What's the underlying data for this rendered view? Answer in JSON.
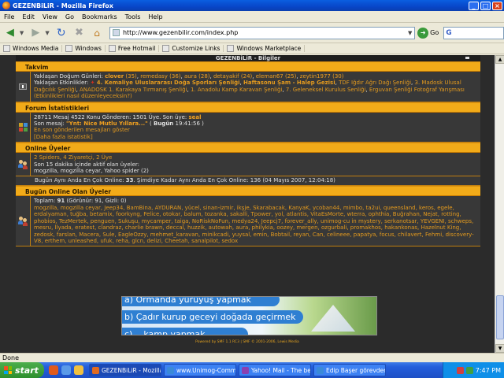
{
  "window": {
    "title": "GEZENBiLiR - Mozilla Firefox",
    "min": "_",
    "max": "□",
    "close": "×"
  },
  "menu": [
    "File",
    "Edit",
    "View",
    "Go",
    "Bookmarks",
    "Tools",
    "Help"
  ],
  "nav": {
    "url": "http://www.gezenbilir.com/index.php",
    "go_label": "Go",
    "search_engine": "G"
  },
  "bookmarks": [
    "Windows Media",
    "Windows",
    "Free Hotmail",
    "Customize Links",
    "Windows Marketplace"
  ],
  "page": {
    "topbar": "GEZENBiLiR - Bilgiler",
    "takvim": {
      "title": "Takvim",
      "birthday_label": "Yaklaşan Doğum Günleri:",
      "birthdays": [
        {
          "name": "clover",
          "age": "(35)"
        },
        {
          "name": "remedasy",
          "age": "(36)"
        },
        {
          "name": "aura",
          "age": "(28)"
        },
        {
          "name": "detayakif",
          "age": "(24)"
        },
        {
          "name": "eleman67",
          "age": "(25)"
        },
        {
          "name": "zeytin1977",
          "age": "(30)"
        }
      ],
      "events_label": "Yaklaşan Etkinlikler:",
      "events": [
        "4. Kemaliye Uluslararası Doğa Sporları Şenliği",
        "Haftasonu Şam - Halep Gezisi",
        "TDF Iğdır Ağrı Dağı Şenliği",
        "3. Madosk Ulusal Dağcılık Şenliği",
        "ANADOSK 1. Karakaya Tırmanış Şenliği",
        "1. Anadolu Kamp Karavan Şenliği",
        "7. Geleneksel Kurulus Senliği",
        "Erguvan Şenliği Fotoğraf Yarışması"
      ],
      "edit_link": "(Etkinlikleri nasıl düzenleyeceksin?)"
    },
    "stats": {
      "title": "Forum İstatistikleri",
      "line1_prefix": "28711 Mesaj 4522 Konu Gönderen: 1501 Üye. Son üye:",
      "last_member": "seal",
      "last_msg_label": "Son mesaj:",
      "last_msg_title": "\"Ynt: Nice Mutlu Yıllara...\"",
      "last_msg_when_prefix": "( ",
      "last_msg_when_day": "Bugün",
      "last_msg_when_time": "19:41:56 )",
      "recent_link": "En son gönderilen mesajları göster",
      "more_link": "[Daha fazla istatistik]"
    },
    "online": {
      "title": "Online Üyeler",
      "summary": "2 Spiders, 4 Ziyaretçi, 2 Üye",
      "last15": "Son 15 dakika içinde aktif olan üyeler:",
      "users": "mogzilla, mogzilla ceyar, Yahoo spider (2)",
      "strip_prefix": "Bugün Aynı Anda En Çok Online:",
      "strip_count": "33",
      "strip_suffix": ". Şimdiye Kadar Aynı Anda En Çok Online: 136 (04 Mayıs 2007, 12:04:18)"
    },
    "today": {
      "title": "Bugün Online Olan Üyeler",
      "total_label": "Toplam:",
      "total_count": "91",
      "total_rest": "(Görünür: 91, Gizli: 0)",
      "users": "mogzilla, mogzilla ceyar, Jeep34, BamBina, AYDURAN, yücel, sinan-izmir, ikşje, Skarabacak, KanyaK, ycoban44, mimbo, ta2ui, queensland, keros, egele, erdalyaman, tuğba, betamix, foorkyng, Felice, otokar, balum, tozanka, sakalli, Tpower, yol, atlantis, VitaEsMorte, wterra, ophthia, Buğrahan, Nejat, rotting, phobios, TezMertek, penguen, Sukuşu, mycamper, taiga, NoRiskNoFun, medya24, Jeepcj7, forever_ally, unimog-cu in mystery, serkanotsar, YEVGENI, schweps, mesru, İlyada, eratest, clandraz, charlie brawn, deccal, huzzik, autowah, aura, philykia, oozey, mergen, ozgurbali, promakhos, hakankonas, Hazelnut King, zedosk, farslan, Macera, Sule, EagleOzzy, mehmet_karavan, minikcadi, yuysal, emin, Bobtail, reyan, Can, celineee, papatya, focus, chilavert, Fehmi, discovery-V8, erthem, unleashed, ufuk, reha, glcn, delizi, Cheetah, sanalpilot, sedox"
    },
    "banner": {
      "line1": "a) Ormanda yürüyüş yapmak",
      "line2": "b) Çadır kurup geceyi doğada geçirmek",
      "line3": "c) ...kamp yapmak"
    },
    "footer": "Powered by SMF 1.1 RC3 | SMF © 2001-2006, Lewis Media"
  },
  "status": "Done",
  "taskbar": {
    "start": "start",
    "tasks": [
      "GEZENBiLiR - Mozilla F...",
      "www.Unimog-Commu...",
      "Yahoo! Mail - The bes...",
      "Edip Başer görevden ..."
    ],
    "clock": "7:47 PM"
  }
}
